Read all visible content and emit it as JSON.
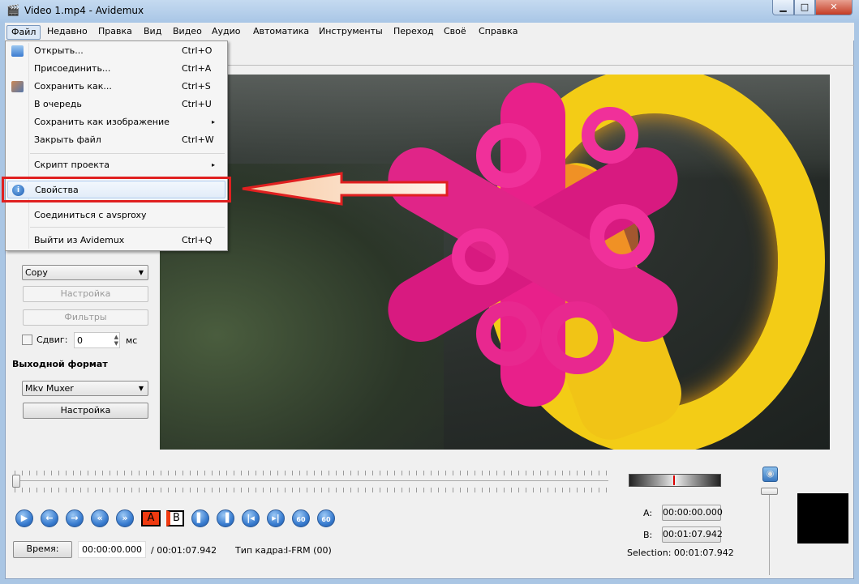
{
  "window": {
    "title": "Video 1.mp4 - Avidemux",
    "minimize": "▁",
    "maximize": "□",
    "close": "✕"
  },
  "menubar": [
    "Файл",
    "Недавно",
    "Правка",
    "Вид",
    "Видео",
    "Аудио",
    "Автоматика",
    "Инструменты",
    "Переход",
    "Своё",
    "Справка"
  ],
  "file_menu": {
    "items": [
      {
        "label": "Открыть...",
        "shortcut": "Ctrl+O",
        "icon": "open-folder-icon"
      },
      {
        "label": "Присоединить...",
        "shortcut": "Ctrl+A"
      },
      {
        "label": "Сохранить как...",
        "shortcut": "Ctrl+S",
        "icon": "save-icon"
      },
      {
        "label": "В очередь",
        "shortcut": "Ctrl+U"
      },
      {
        "label": "Сохранить как изображение",
        "submenu": "▸"
      },
      {
        "label": "Закрыть файл",
        "shortcut": "Ctrl+W"
      },
      {
        "label": "Скрипт проекта",
        "submenu": "▸"
      },
      {
        "label": "Свойства",
        "icon": "info-icon"
      },
      {
        "label": "Соединиться с avsproxy"
      },
      {
        "label": "Выйти из Avidemux",
        "shortcut": "Ctrl+Q"
      }
    ],
    "highlight_color": "#e02020"
  },
  "left_panel": {
    "audio_codec": "Copy",
    "audio_settings": "Настройка",
    "audio_filters": "Фильтры",
    "shift_label": "Сдвиг:",
    "shift_value": "0",
    "shift_unit": "мс",
    "output_format_title": "Выходной формат",
    "muxer": "Mkv Muxer",
    "muxer_settings": "Настройка"
  },
  "playback": {
    "marker_a": "A",
    "marker_b": "B",
    "goto_label": "60"
  },
  "time": {
    "button": "Время:",
    "current": "00:00:00.000",
    "total": "/ 00:01:07.942",
    "frame_type_label": "Тип кадра:",
    "frame_type": "I-FRM (00)"
  },
  "selection": {
    "a_label": "A:",
    "a_value": "00:00:00.000",
    "b_label": "B:",
    "b_value": "00:01:07.942",
    "selection_text": "Selection: 00:01:07.942"
  },
  "slider_position": 0
}
